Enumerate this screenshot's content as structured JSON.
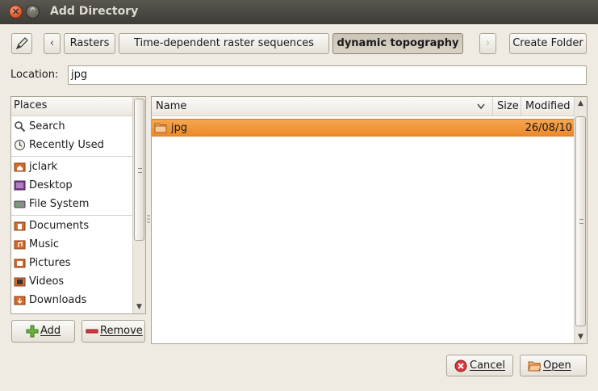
{
  "window": {
    "title": "Add Directory",
    "close_glyph": "×",
    "min_glyph": "^"
  },
  "pathbar": {
    "back_glyph": "‹",
    "forward_glyph": "›",
    "crumbs": [
      "Rasters",
      "Time-dependent raster sequences",
      "dynamic topography"
    ],
    "active_crumb": "dynamic topography",
    "create_folder_label": "Create Folder"
  },
  "location": {
    "label": "Location:",
    "value": "jpg"
  },
  "places": {
    "header": "Places",
    "items": [
      {
        "label": "Search",
        "icon": "search-icon"
      },
      {
        "label": "Recently Used",
        "icon": "clock-icon"
      },
      {
        "label": "jclark",
        "icon": "home-folder-icon"
      },
      {
        "label": "Desktop",
        "icon": "desktop-icon"
      },
      {
        "label": "File System",
        "icon": "harddisk-icon"
      },
      {
        "label": "Documents",
        "icon": "documents-folder-icon"
      },
      {
        "label": "Music",
        "icon": "music-folder-icon"
      },
      {
        "label": "Pictures",
        "icon": "pictures-folder-icon"
      },
      {
        "label": "Videos",
        "icon": "videos-folder-icon"
      },
      {
        "label": "Downloads",
        "icon": "downloads-folder-icon"
      }
    ],
    "add_label": "Add",
    "remove_label": "Remove"
  },
  "files": {
    "columns": [
      "Name",
      "Size",
      "Modified"
    ],
    "rows": [
      {
        "name": "jpg",
        "size": "",
        "modified": "26/08/10",
        "icon": "folder-icon",
        "selected": true
      }
    ]
  },
  "actions": {
    "cancel_label": "Cancel",
    "open_label": "Open"
  },
  "colors": {
    "selection": "#ed8a2a",
    "titlebar": "#3c3b37",
    "background": "#f0ebe2"
  }
}
